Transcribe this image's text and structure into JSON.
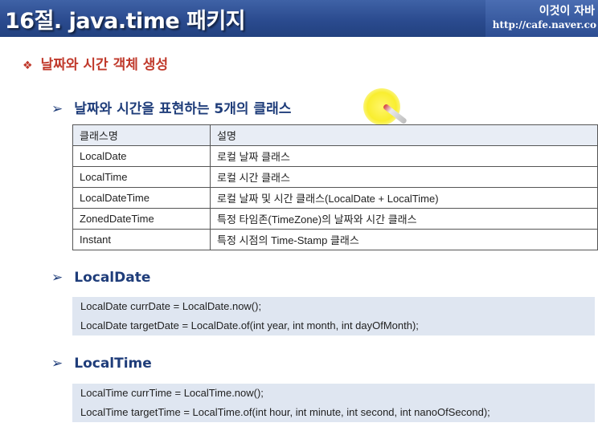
{
  "header": {
    "title": "16절. java.time 패키지",
    "brand": "이것이 자바",
    "url": "http://cafe.naver.co"
  },
  "section": {
    "bullet_icon": "diamond-bullet",
    "title": "날짜와 시간 객체 생성"
  },
  "subsections": [
    {
      "arrow_icon": "arrow-right",
      "title": "날짜와 시간을 표현하는 5개의 클래스"
    },
    {
      "arrow_icon": "arrow-right",
      "title": "LocalDate"
    },
    {
      "arrow_icon": "arrow-right",
      "title": "LocalTime"
    }
  ],
  "table": {
    "headers": [
      "클래스명",
      "설명"
    ],
    "rows": [
      [
        "LocalDate",
        "로컬 날짜 클래스"
      ],
      [
        "LocalTime",
        "로컬 시간 클래스"
      ],
      [
        "LocalDateTime",
        "로컬 날짜 및 시간 클래스(LocalDate + LocalTime)"
      ],
      [
        "ZonedDateTime",
        "특정 타임존(TimeZone)의 날짜와 시간 클래스"
      ],
      [
        "Instant",
        "특정 시점의 Time-Stamp 클래스"
      ]
    ]
  },
  "code": {
    "localdate": [
      "LocalDate currDate = LocalDate.now();",
      "LocalDate targetDate = LocalDate.of(int  year, int month, int dayOfMonth);"
    ],
    "localtime": [
      "LocalTime currTime = LocalTime.now();",
      "LocalTime targetTime = LocalTime.of(int  hour, int minute, int second, int nanoOfSecond);"
    ]
  },
  "colors": {
    "header_bg": "#2b4b8f",
    "section_title": "#c0392b",
    "subsection_title": "#1f3d7a",
    "code_bg": "#dfe6f1",
    "pointer_highlight": "#f9ee2f"
  }
}
